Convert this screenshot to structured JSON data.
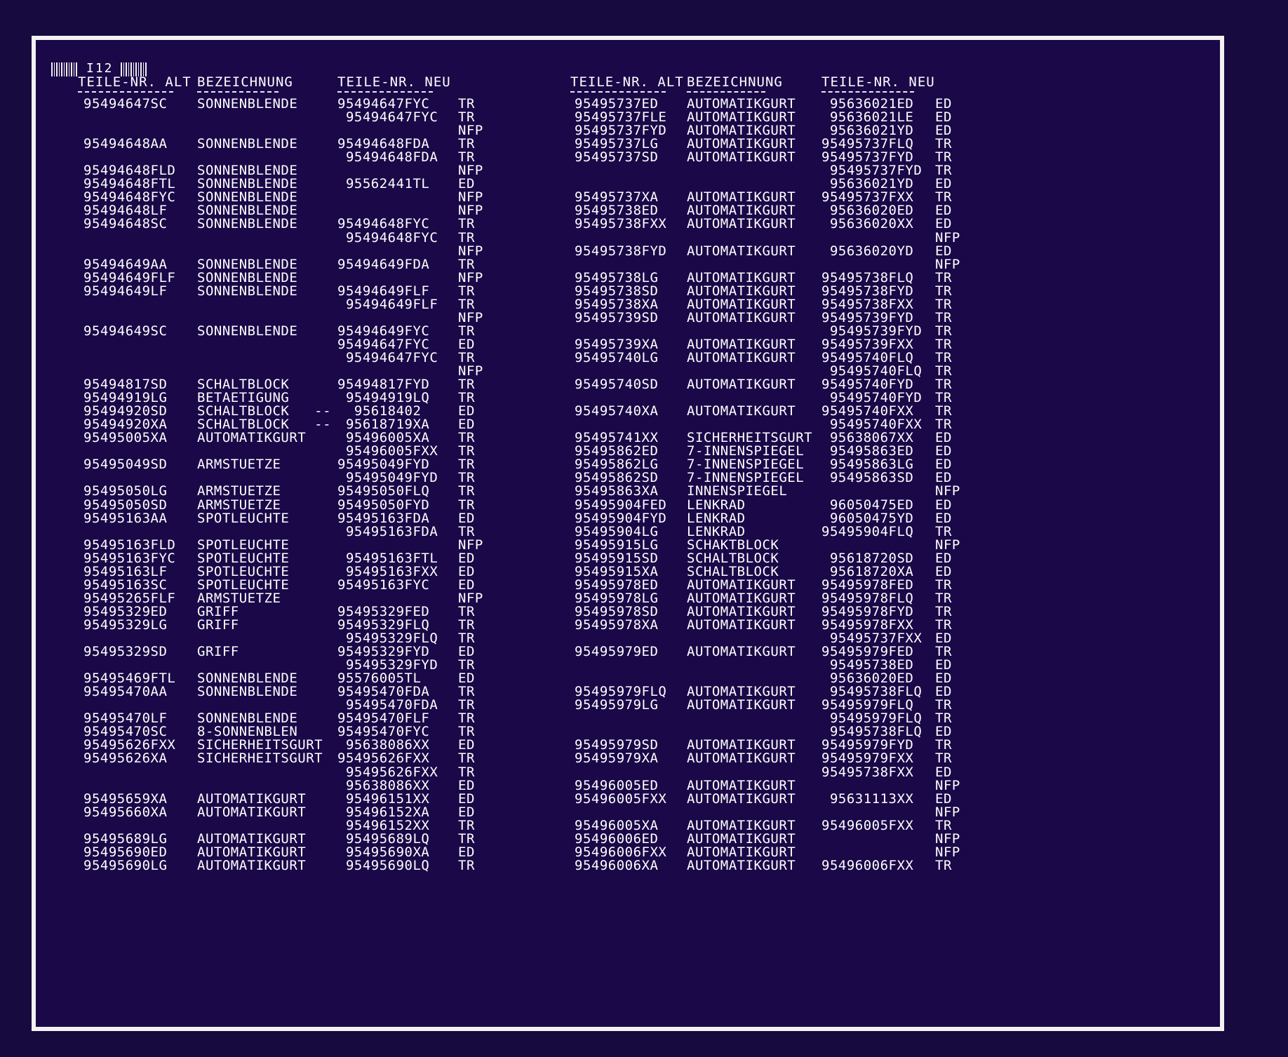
{
  "sheet_id": "I12",
  "headers": {
    "left": [
      "TEILE-NR. ALT",
      "BEZEICHNUNG",
      "TEILE-NR. NEU"
    ],
    "right": [
      "TEILE-NR. ALT",
      "BEZEICHNUNG",
      "TEILE-NR. NEU"
    ]
  },
  "left_rows": [
    [
      "95494647SC",
      "SONNENBLENDE",
      "95494647FYC",
      "TR"
    ],
    [
      "",
      "",
      " 95494647FYC",
      "TR"
    ],
    [
      "",
      "",
      "",
      "NFP"
    ],
    [
      "95494648AA",
      "SONNENBLENDE",
      "95494648FDA",
      "TR"
    ],
    [
      "",
      "",
      " 95494648FDA",
      "TR"
    ],
    [
      "95494648FLD",
      "SONNENBLENDE",
      "",
      "NFP"
    ],
    [
      "95494648FTL",
      "SONNENBLENDE",
      " 95562441TL",
      "ED"
    ],
    [
      "95494648FYC",
      "SONNENBLENDE",
      "",
      "NFP"
    ],
    [
      "95494648LF",
      "SONNENBLENDE",
      "",
      "NFP"
    ],
    [
      "95494648SC",
      "SONNENBLENDE",
      "95494648FYC",
      "TR"
    ],
    [
      "",
      "",
      " 95494648FYC",
      "TR"
    ],
    [
      "",
      "",
      "",
      "NFP"
    ],
    [
      "95494649AA",
      "SONNENBLENDE",
      "95494649FDA",
      "TR"
    ],
    [
      "95494649FLF",
      "SONNENBLENDE",
      "",
      "NFP"
    ],
    [
      "95494649LF",
      "SONNENBLENDE",
      "95494649FLF",
      "TR"
    ],
    [
      "",
      "",
      " 95494649FLF",
      "TR"
    ],
    [
      "",
      "",
      "",
      "NFP"
    ],
    [
      "95494649SC",
      "SONNENBLENDE",
      "95494649FYC",
      "TR"
    ],
    [
      "",
      "",
      "95494647FYC",
      "ED"
    ],
    [
      "",
      "",
      " 95494647FYC",
      "TR"
    ],
    [
      "",
      "",
      "",
      "NFP"
    ],
    [
      "95494817SD",
      "SCHALTBLOCK",
      "95494817FYD",
      "TR"
    ],
    [
      "95494919LG",
      "BETAETIGUNG",
      " 95494919LQ",
      "TR"
    ],
    [
      "95494920SD",
      "SCHALTBLOCK   --",
      "  95618402",
      "ED"
    ],
    [
      "95494920XA",
      "SCHALTBLOCK   --",
      " 95618719XA",
      "ED"
    ],
    [
      "95495005XA",
      "AUTOMATIKGURT",
      " 95496005XA",
      "TR"
    ],
    [
      "",
      "",
      " 95496005FXX",
      "TR"
    ],
    [
      "95495049SD",
      "ARMSTUETZE",
      "95495049FYD",
      "TR"
    ],
    [
      "",
      "",
      " 95495049FYD",
      "TR"
    ],
    [
      "95495050LG",
      "ARMSTUETZE",
      "95495050FLQ",
      "TR"
    ],
    [
      "95495050SD",
      "ARMSTUETZE",
      "95495050FYD",
      "TR"
    ],
    [
      "95495163AA",
      "SPOTLEUCHTE",
      "95495163FDA",
      "ED"
    ],
    [
      "",
      "",
      " 95495163FDA",
      "TR"
    ],
    [
      "95495163FLD",
      "SPOTLEUCHTE",
      "",
      "NFP"
    ],
    [
      "95495163FYC",
      "SPOTLEUCHTE",
      " 95495163FTL",
      "ED"
    ],
    [
      "95495163LF",
      "SPOTLEUCHTE",
      " 95495163FXX",
      "ED"
    ],
    [
      "95495163SC",
      "SPOTLEUCHTE",
      "95495163FYC",
      "ED"
    ],
    [
      "95495265FLF",
      "ARMSTUETZE",
      "",
      "NFP"
    ],
    [
      "95495329ED",
      "GRIFF",
      "95495329FED",
      "TR"
    ],
    [
      "95495329LG",
      "GRIFF",
      "95495329FLQ",
      "TR"
    ],
    [
      "",
      "",
      " 95495329FLQ",
      "TR"
    ],
    [
      "95495329SD",
      "GRIFF",
      "95495329FYD",
      "ED"
    ],
    [
      "",
      "",
      " 95495329FYD",
      "TR"
    ],
    [
      "95495469FTL",
      "SONNENBLENDE",
      "95576005TL",
      "ED"
    ],
    [
      "95495470AA",
      "SONNENBLENDE",
      "95495470FDA",
      "TR"
    ],
    [
      "",
      "",
      " 95495470FDA",
      "TR"
    ],
    [
      "95495470LF",
      "SONNENBLENDE",
      "95495470FLF",
      "TR"
    ],
    [
      "95495470SC",
      "8-SONNENBLEN",
      "95495470FYC",
      "TR"
    ],
    [
      "95495626FXX",
      "SICHERHEITSGURT",
      " 95638086XX",
      "ED"
    ],
    [
      "95495626XA",
      "SICHERHEITSGURT",
      "95495626FXX",
      "TR"
    ],
    [
      "",
      "",
      " 95495626FXX",
      "TR"
    ],
    [
      "",
      "",
      " 95638086XX",
      "ED"
    ],
    [
      "95495659XA",
      "AUTOMATIKGURT",
      " 95496151XX",
      "ED"
    ],
    [
      "95495660XA",
      "AUTOMATIKGURT",
      " 95496152XA",
      "ED"
    ],
    [
      "",
      "",
      " 95496152XX",
      "TR"
    ],
    [
      "95495689LG",
      "AUTOMATIKGURT",
      " 95495689LQ",
      "TR"
    ],
    [
      "95495690ED",
      "AUTOMATIKGURT",
      " 95495690XA",
      "ED"
    ],
    [
      "95495690LG",
      "AUTOMATIKGURT",
      " 95495690LQ",
      "TR"
    ]
  ],
  "right_rows": [
    [
      "95495737ED",
      "AUTOMATIKGURT",
      " 95636021ED",
      "ED"
    ],
    [
      "95495737FLE",
      "AUTOMATIKGURT",
      " 95636021LE",
      "ED"
    ],
    [
      "95495737FYD",
      "AUTOMATIKGURT",
      " 95636021YD",
      "ED"
    ],
    [
      "95495737LG",
      "AUTOMATIKGURT",
      "95495737FLQ",
      "TR"
    ],
    [
      "95495737SD",
      "AUTOMATIKGURT",
      "95495737FYD",
      "TR"
    ],
    [
      "",
      "",
      " 95495737FYD",
      "TR"
    ],
    [
      "",
      "",
      " 95636021YD",
      "ED"
    ],
    [
      "95495737XA",
      "AUTOMATIKGURT",
      "95495737FXX",
      "TR"
    ],
    [
      "95495738ED",
      "AUTOMATIKGURT",
      " 95636020ED",
      "ED"
    ],
    [
      "95495738FXX",
      "AUTOMATIKGURT",
      " 95636020XX",
      "ED"
    ],
    [
      "",
      "",
      "",
      "NFP"
    ],
    [
      "95495738FYD",
      "AUTOMATIKGURT",
      " 95636020YD",
      "ED"
    ],
    [
      "",
      "",
      "",
      "NFP"
    ],
    [
      "95495738LG",
      "AUTOMATIKGURT",
      "95495738FLQ",
      "TR"
    ],
    [
      "95495738SD",
      "AUTOMATIKGURT",
      "95495738FYD",
      "TR"
    ],
    [
      "95495738XA",
      "AUTOMATIKGURT",
      "95495738FXX",
      "TR"
    ],
    [
      "95495739SD",
      "AUTOMATIKGURT",
      "95495739FYD",
      "TR"
    ],
    [
      "",
      "",
      " 95495739FYD",
      "TR"
    ],
    [
      "95495739XA",
      "AUTOMATIKGURT",
      "95495739FXX",
      "TR"
    ],
    [
      "95495740LG",
      "AUTOMATIKGURT",
      "95495740FLQ",
      "TR"
    ],
    [
      "",
      "",
      " 95495740FLQ",
      "TR"
    ],
    [
      "95495740SD",
      "AUTOMATIKGURT",
      "95495740FYD",
      "TR"
    ],
    [
      "",
      "",
      " 95495740FYD",
      "TR"
    ],
    [
      "95495740XA",
      "AUTOMATIKGURT",
      "95495740FXX",
      "TR"
    ],
    [
      "",
      "",
      " 95495740FXX",
      "TR"
    ],
    [
      "95495741XX",
      "SICHERHEITSGURT",
      " 95638067XX",
      "ED"
    ],
    [
      "95495862ED",
      "7-INNENSPIEGEL",
      " 95495863ED",
      "ED"
    ],
    [
      "95495862LG",
      "7-INNENSPIEGEL",
      " 95495863LG",
      "ED"
    ],
    [
      "95495862SD",
      "7-INNENSPIEGEL",
      " 95495863SD",
      "ED"
    ],
    [
      "95495863XA",
      "INNENSPIEGEL",
      "",
      "NFP"
    ],
    [
      "95495904FED",
      "LENKRAD",
      " 96050475ED",
      "ED"
    ],
    [
      "95495904FYD",
      "LENKRAD",
      " 96050475YD",
      "ED"
    ],
    [
      "95495904LG",
      "LENKRAD",
      "95495904FLQ",
      "TR"
    ],
    [
      "95495915LG",
      "SCHAKTBLOCK",
      "",
      "NFP"
    ],
    [
      "95495915SD",
      "SCHALTBLOCK",
      " 95618720SD",
      "ED"
    ],
    [
      "95495915XA",
      "SCHALTBLOCK",
      " 95618720XA",
      "ED"
    ],
    [
      "95495978ED",
      "AUTOMATIKGURT",
      "95495978FED",
      "TR"
    ],
    [
      "95495978LG",
      "AUTOMATIKGURT",
      "95495978FLQ",
      "TR"
    ],
    [
      "95495978SD",
      "AUTOMATIKGURT",
      "95495978FYD",
      "TR"
    ],
    [
      "95495978XA",
      "AUTOMATIKGURT",
      "95495978FXX",
      "TR"
    ],
    [
      "",
      "",
      " 95495737FXX",
      "ED"
    ],
    [
      "95495979ED",
      "AUTOMATIKGURT",
      "95495979FED",
      "TR"
    ],
    [
      "",
      "",
      " 95495738ED",
      "ED"
    ],
    [
      "",
      "",
      " 95636020ED",
      "ED"
    ],
    [
      "95495979FLQ",
      "AUTOMATIKGURT",
      " 95495738FLQ",
      "ED"
    ],
    [
      "95495979LG",
      "AUTOMATIKGURT",
      "95495979FLQ",
      "TR"
    ],
    [
      "",
      "",
      " 95495979FLQ",
      "TR"
    ],
    [
      "",
      "",
      " 95495738FLQ",
      "ED"
    ],
    [
      "95495979SD",
      "AUTOMATIKGURT",
      "95495979FYD",
      "TR"
    ],
    [
      "95495979XA",
      "AUTOMATIKGURT",
      "95495979FXX",
      "TR"
    ],
    [
      "",
      "",
      "95495738FXX",
      "ED"
    ],
    [
      "95496005ED",
      "AUTOMATIKGURT",
      "",
      "NFP"
    ],
    [
      "95496005FXX",
      "AUTOMATIKGURT",
      " 95631113XX",
      "ED"
    ],
    [
      "",
      "",
      "",
      "NFP"
    ],
    [
      "95496005XA",
      "AUTOMATIKGURT",
      "95496005FXX",
      "TR"
    ],
    [
      "95496006ED",
      "AUTOMATIKGURT",
      "",
      "NFP"
    ],
    [
      "95496006FXX",
      "AUTOMATIKGURT",
      "",
      "NFP"
    ],
    [
      "95496006XA",
      "AUTOMATIKGURT",
      "95496006FXX",
      "TR"
    ]
  ]
}
